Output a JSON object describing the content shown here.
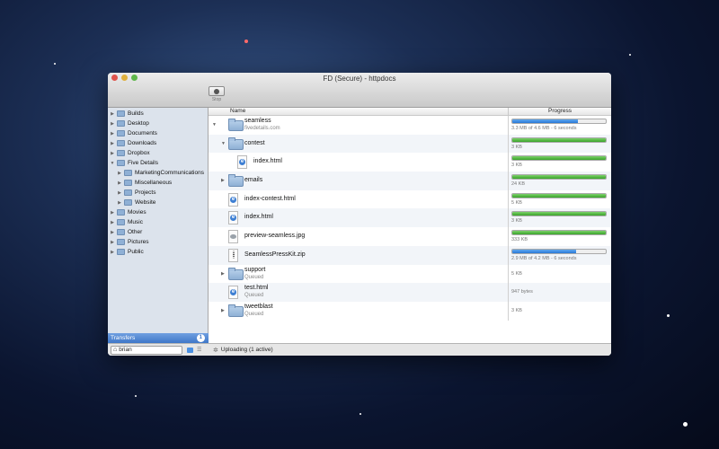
{
  "window": {
    "title": "FD (Secure) - httpdocs"
  },
  "toolbar": {
    "stop_label": "Stop"
  },
  "sidebar": {
    "items": [
      {
        "label": "Builds",
        "expanded": false
      },
      {
        "label": "Desktop",
        "expanded": false
      },
      {
        "label": "Documents",
        "expanded": false
      },
      {
        "label": "Downloads",
        "expanded": false
      },
      {
        "label": "Dropbox",
        "expanded": false
      },
      {
        "label": "Five Details",
        "expanded": true
      },
      {
        "label": "MarketingCommunications",
        "indent": 1
      },
      {
        "label": "Miscellaneous",
        "indent": 1
      },
      {
        "label": "Projects",
        "indent": 1
      },
      {
        "label": "Website",
        "indent": 1
      },
      {
        "label": "Movies",
        "expanded": false
      },
      {
        "label": "Music",
        "expanded": false
      },
      {
        "label": "Other",
        "expanded": false
      },
      {
        "label": "Pictures",
        "expanded": false
      },
      {
        "label": "Public",
        "expanded": false
      }
    ],
    "transfers_label": "Transfers",
    "transfers_count": "1",
    "user": "brian"
  },
  "columns": {
    "name": "Name",
    "progress": "Progress"
  },
  "rows": [
    {
      "name": "seamless",
      "sub": "fivedetails.com",
      "icon": "folder-icon",
      "expander": "open",
      "progress_text": "3.3 MB of 4.6 MB - 6 seconds",
      "progress": 0.7,
      "bar_color": "#2a78d6"
    },
    {
      "name": "contest",
      "sub": "",
      "icon": "folder-icon",
      "expander": "open",
      "progress_text": "3 KB",
      "progress": 1.0,
      "bar_color": "#3aa42a"
    },
    {
      "name": "index.html",
      "sub": "",
      "icon": "html-file-icon",
      "progress_text": "3 KB",
      "progress": 1.0,
      "bar_color": "#3aa42a"
    },
    {
      "name": "emails",
      "sub": "",
      "icon": "folder-icon",
      "expander": "closed",
      "progress_text": "24 KB",
      "progress": 1.0,
      "bar_color": "#3aa42a"
    },
    {
      "name": "index-contest.html",
      "sub": "",
      "icon": "html-file-icon",
      "progress_text": "5 KB",
      "progress": 1.0,
      "bar_color": "#3aa42a"
    },
    {
      "name": "index.html",
      "sub": "",
      "icon": "html-file-icon",
      "progress_text": "3 KB",
      "progress": 1.0,
      "bar_color": "#3aa42a"
    },
    {
      "name": "preview-seamless.jpg",
      "sub": "",
      "icon": "image-file-icon",
      "progress_text": "333 KB",
      "progress": 1.0,
      "bar_color": "#3aa42a"
    },
    {
      "name": "SeamlessPressKit.zip",
      "sub": "",
      "icon": "zip-file-icon",
      "progress_text": "2.9 MB of 4.2 MB - 6 seconds",
      "progress": 0.68,
      "bar_color": "#2a78d6"
    },
    {
      "name": "support",
      "sub": "Queued",
      "icon": "folder-icon",
      "expander": "closed",
      "progress_text": "5 KB",
      "progress": null
    },
    {
      "name": "test.html",
      "sub": "Queued",
      "icon": "html-file-icon",
      "progress_text": "947 bytes",
      "progress": null
    },
    {
      "name": "tweetblast",
      "sub": "Queued",
      "icon": "folder-icon",
      "expander": "closed",
      "progress_text": "3 KB",
      "progress": null
    }
  ],
  "status": {
    "text": "Uploading (1 active)"
  }
}
